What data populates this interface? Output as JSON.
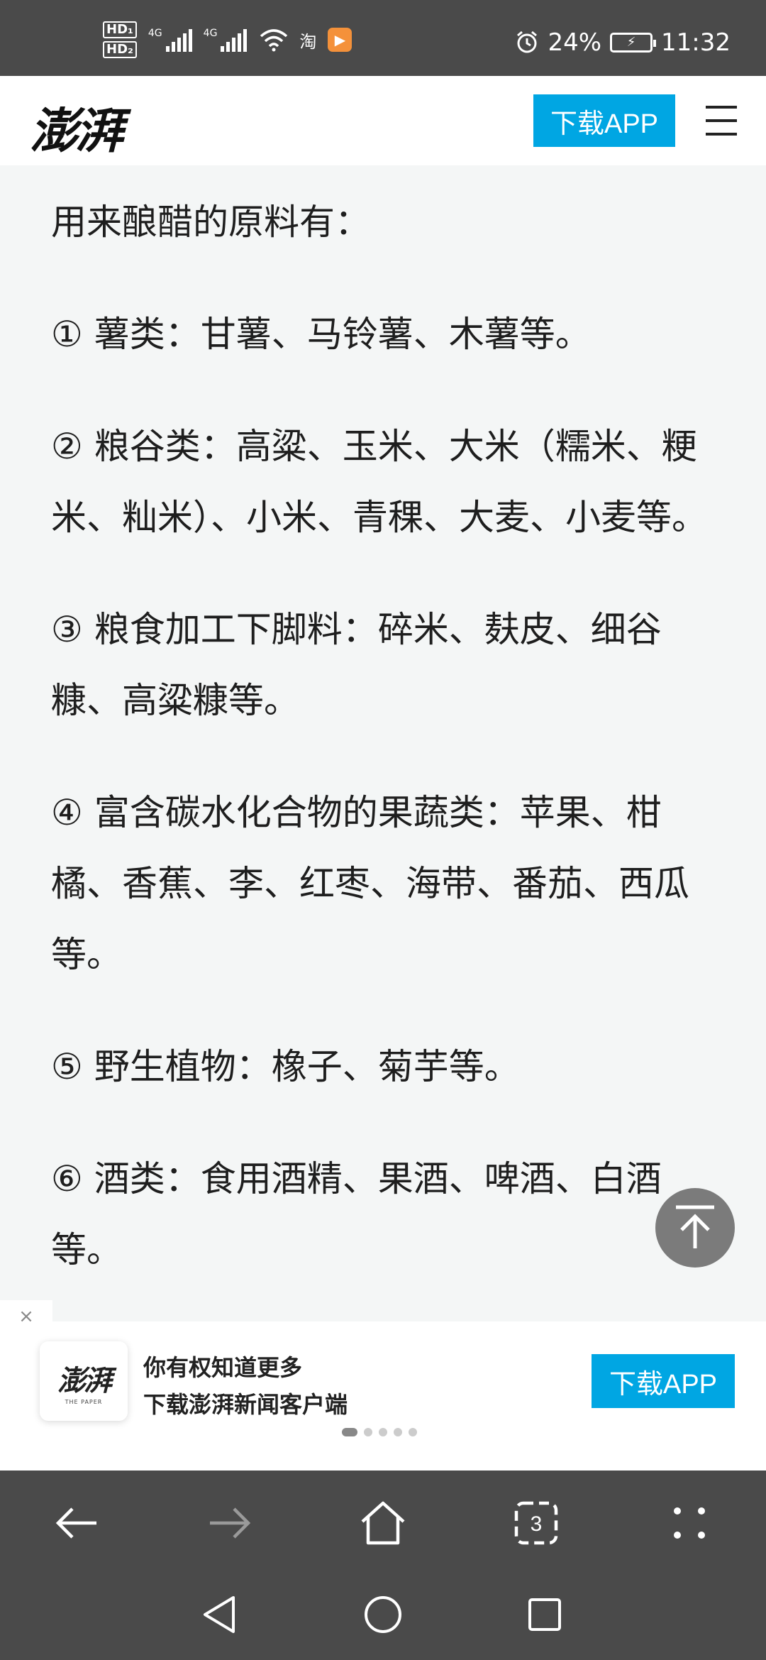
{
  "status_bar": {
    "hd1": "HD₁",
    "hd2": "HD₂",
    "net1": "4G",
    "net2": "4G",
    "taobao": "淘",
    "battery": "24%",
    "time": "11:32"
  },
  "header": {
    "logo": "澎湃",
    "download_label": "下载APP"
  },
  "article": {
    "paragraphs": [
      "用来酿醋的原料有：",
      "① 薯类：甘薯、马铃薯、木薯等。",
      "② 粮谷类：高粱、玉米、大米（糯米、粳米、籼米）、小米、青稞、大麦、小麦等。",
      "③ 粮食加工下脚料：碎米、麸皮、细谷糠、高粱糠等。",
      "④ 富含碳水化合物的果蔬类：苹果、柑橘、香蕉、李、红枣、海带、番茄、西瓜等。",
      "⑤ 野生植物：橡子、菊芋等。",
      "⑥ 酒类：食用酒精、果酒、啤酒、白酒等。"
    ]
  },
  "banner": {
    "close": "×",
    "app_brand": "澎湃",
    "app_sub": "THE PAPER",
    "line1": "你有权知道更多",
    "line2": "下载澎湃新闻客户端",
    "download_label": "下载APP",
    "page_count": 5,
    "active_page": 1
  },
  "toolbar": {
    "tab_count": "3"
  },
  "colors": {
    "accent": "#00a6e3",
    "bar": "#4a4a4a",
    "page_bg": "#f4f6f6"
  }
}
